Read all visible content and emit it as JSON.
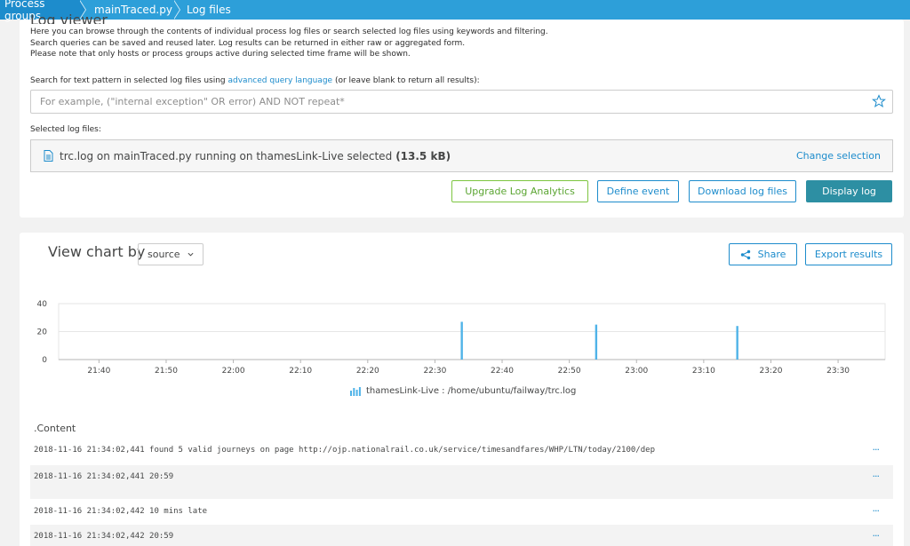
{
  "breadcrumb": [
    "Process groups",
    "mainTraced.py",
    "Log files"
  ],
  "top_panel": {
    "title_clipped": "Log viewer",
    "description_lines": [
      "Here you can browse through the contents of individual process log files or search selected log files using keywords and filtering.",
      "Search queries can be saved and reused later. Log results can be returned in either raw or aggregated form.",
      "Please note that only hosts or process groups active during selected time frame will be shown."
    ],
    "search_label_pre": "Search for text pattern in selected log files using ",
    "search_label_link": "advanced query language",
    "search_label_post": " (or leave blank to return all results):",
    "search_placeholder": "For example, (\"internal exception\" OR error) AND NOT repeat*",
    "search_value": "",
    "selected_label": "Selected log files:",
    "selected_file_text": "trc.log on mainTraced.py running on thamesLink-Live selected",
    "selected_file_size": "(13.5 kB)",
    "change_selection": "Change selection",
    "buttons": {
      "upgrade": "Upgrade Log Analytics",
      "define_event": "Define event",
      "download": "Download log files",
      "display": "Display log"
    }
  },
  "chart_panel": {
    "view_by_label": "View chart by",
    "view_by_value": "source",
    "share": "Share",
    "export": "Export results",
    "legend": "thamesLink-Live : /home/ubuntu/failway/trc.log",
    "content_title": ".Content",
    "log_rows": [
      "2018-11-16 21:34:02,441 found 5 valid journeys on page http://ojp.nationalrail.co.uk/service/timesandfares/WHP/LTN/today/2100/dep",
      "2018-11-16 21:34:02,441 20:59",
      "2018-11-16 21:34:02,442 10 mins late",
      "2018-11-16 21:34:02,442 20:59"
    ],
    "more_glyph": "···"
  },
  "chart_data": {
    "type": "bar",
    "x": [
      "22:34",
      "22:54",
      "23:15"
    ],
    "values": [
      27,
      25,
      24
    ],
    "x_ticks": [
      "21:40",
      "21:50",
      "22:00",
      "22:10",
      "22:20",
      "22:30",
      "22:40",
      "22:50",
      "23:00",
      "23:10",
      "23:20",
      "23:30"
    ],
    "y_ticks": [
      0,
      20,
      40
    ],
    "ylim": [
      0,
      40
    ],
    "x_range": [
      "21:34",
      "23:37"
    ],
    "grid": true,
    "color": "#4fb3e8"
  }
}
